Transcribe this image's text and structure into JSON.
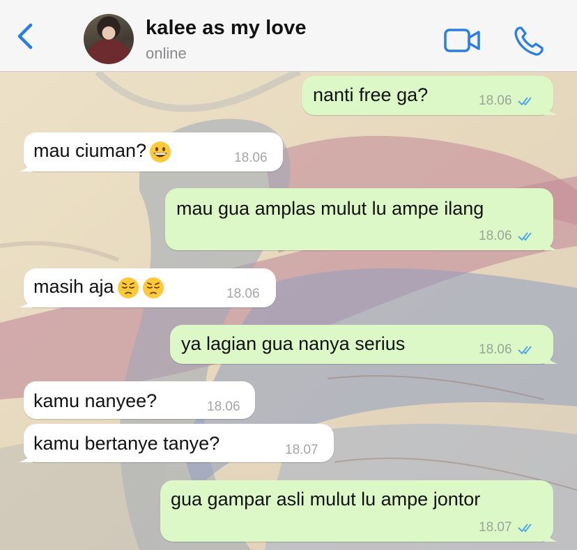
{
  "header": {
    "back_icon": "chevron-left-icon",
    "contact_name": "kalee as my love",
    "contact_status": "online",
    "video_icon": "video-camera-icon",
    "call_icon": "phone-icon",
    "accent_color": "#2a7de1"
  },
  "messages": [
    {
      "direction": "out",
      "text": "nanti free ga?",
      "time": "18.06",
      "status": "read"
    },
    {
      "direction": "in",
      "text": "mau ciuman?",
      "emoji": [
        "grinning-face"
      ],
      "time": "18.06"
    },
    {
      "direction": "out",
      "text": "mau gua amplas mulut lu ampe ilang",
      "time": "18.06",
      "status": "read"
    },
    {
      "direction": "in",
      "text": "masih aja",
      "emoji": [
        "pensive-face",
        "pensive-face"
      ],
      "time": "18.06"
    },
    {
      "direction": "out",
      "text": "ya lagian gua nanya serius",
      "time": "18.06",
      "status": "read"
    },
    {
      "direction": "in",
      "text": "kamu nanyee?",
      "time": "18.06"
    },
    {
      "direction": "in",
      "text": "kamu bertanye tanye?",
      "time": "18.07"
    },
    {
      "direction": "out",
      "text": "gua gampar asli mulut lu ampe jontor",
      "time": "18.07",
      "status": "read"
    }
  ],
  "colors": {
    "incoming_bubble": "#ffffff",
    "outgoing_bubble": "#dcf8c6",
    "read_ticks": "#4fa9e6"
  }
}
